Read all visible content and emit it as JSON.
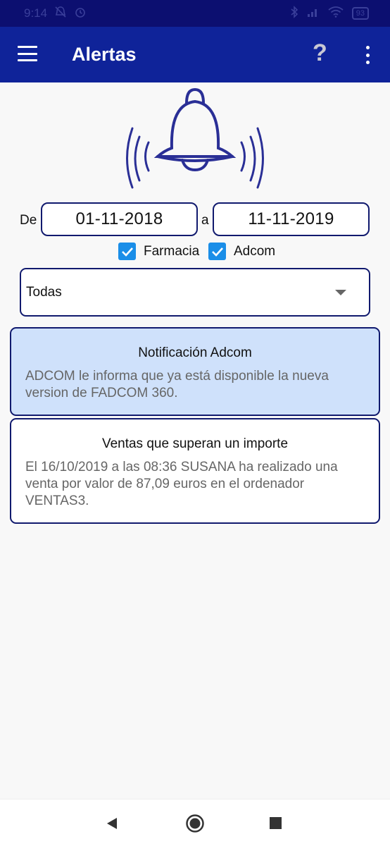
{
  "status_bar": {
    "time": "9:14",
    "battery": "93",
    "icons": [
      "mute-icon",
      "alarm-icon",
      "bluetooth-icon",
      "signal-icon",
      "wifi-icon"
    ]
  },
  "app_bar": {
    "title": "Alertas",
    "help_label": "?",
    "icons": [
      "menu-icon",
      "help-icon",
      "more-vert-icon"
    ]
  },
  "header_icon": "bell-ringing-icon",
  "filters": {
    "from_label": "De",
    "from_date": "01-11-2018",
    "to_label": "a",
    "to_date": "11-11-2019",
    "checkboxes": [
      {
        "label": "Farmacia",
        "checked": true
      },
      {
        "label": "Adcom",
        "checked": true
      }
    ],
    "select": {
      "value": "Todas"
    }
  },
  "alerts": [
    {
      "title": "Notificación Adcom",
      "body": "ADCOM le informa que ya está disponible la nueva version de FADCOM 360.",
      "highlighted": true
    },
    {
      "title": "Ventas que superan un importe",
      "body": "El 16/10/2019 a las 08:36 SUSANA ha realizado una venta por valor de 87,09 euros en el ordenador VENTAS3.",
      "highlighted": false
    }
  ],
  "colors": {
    "status_bar": "#0c0f70",
    "app_bar": "#0f2399",
    "bell": "#2a2f96",
    "checkbox": "#1a8ee8",
    "highlight_card": "#cfe1fb",
    "border": "#111a6e"
  },
  "nav_bar": {
    "icons": [
      "back-icon",
      "home-icon",
      "recents-icon"
    ]
  }
}
